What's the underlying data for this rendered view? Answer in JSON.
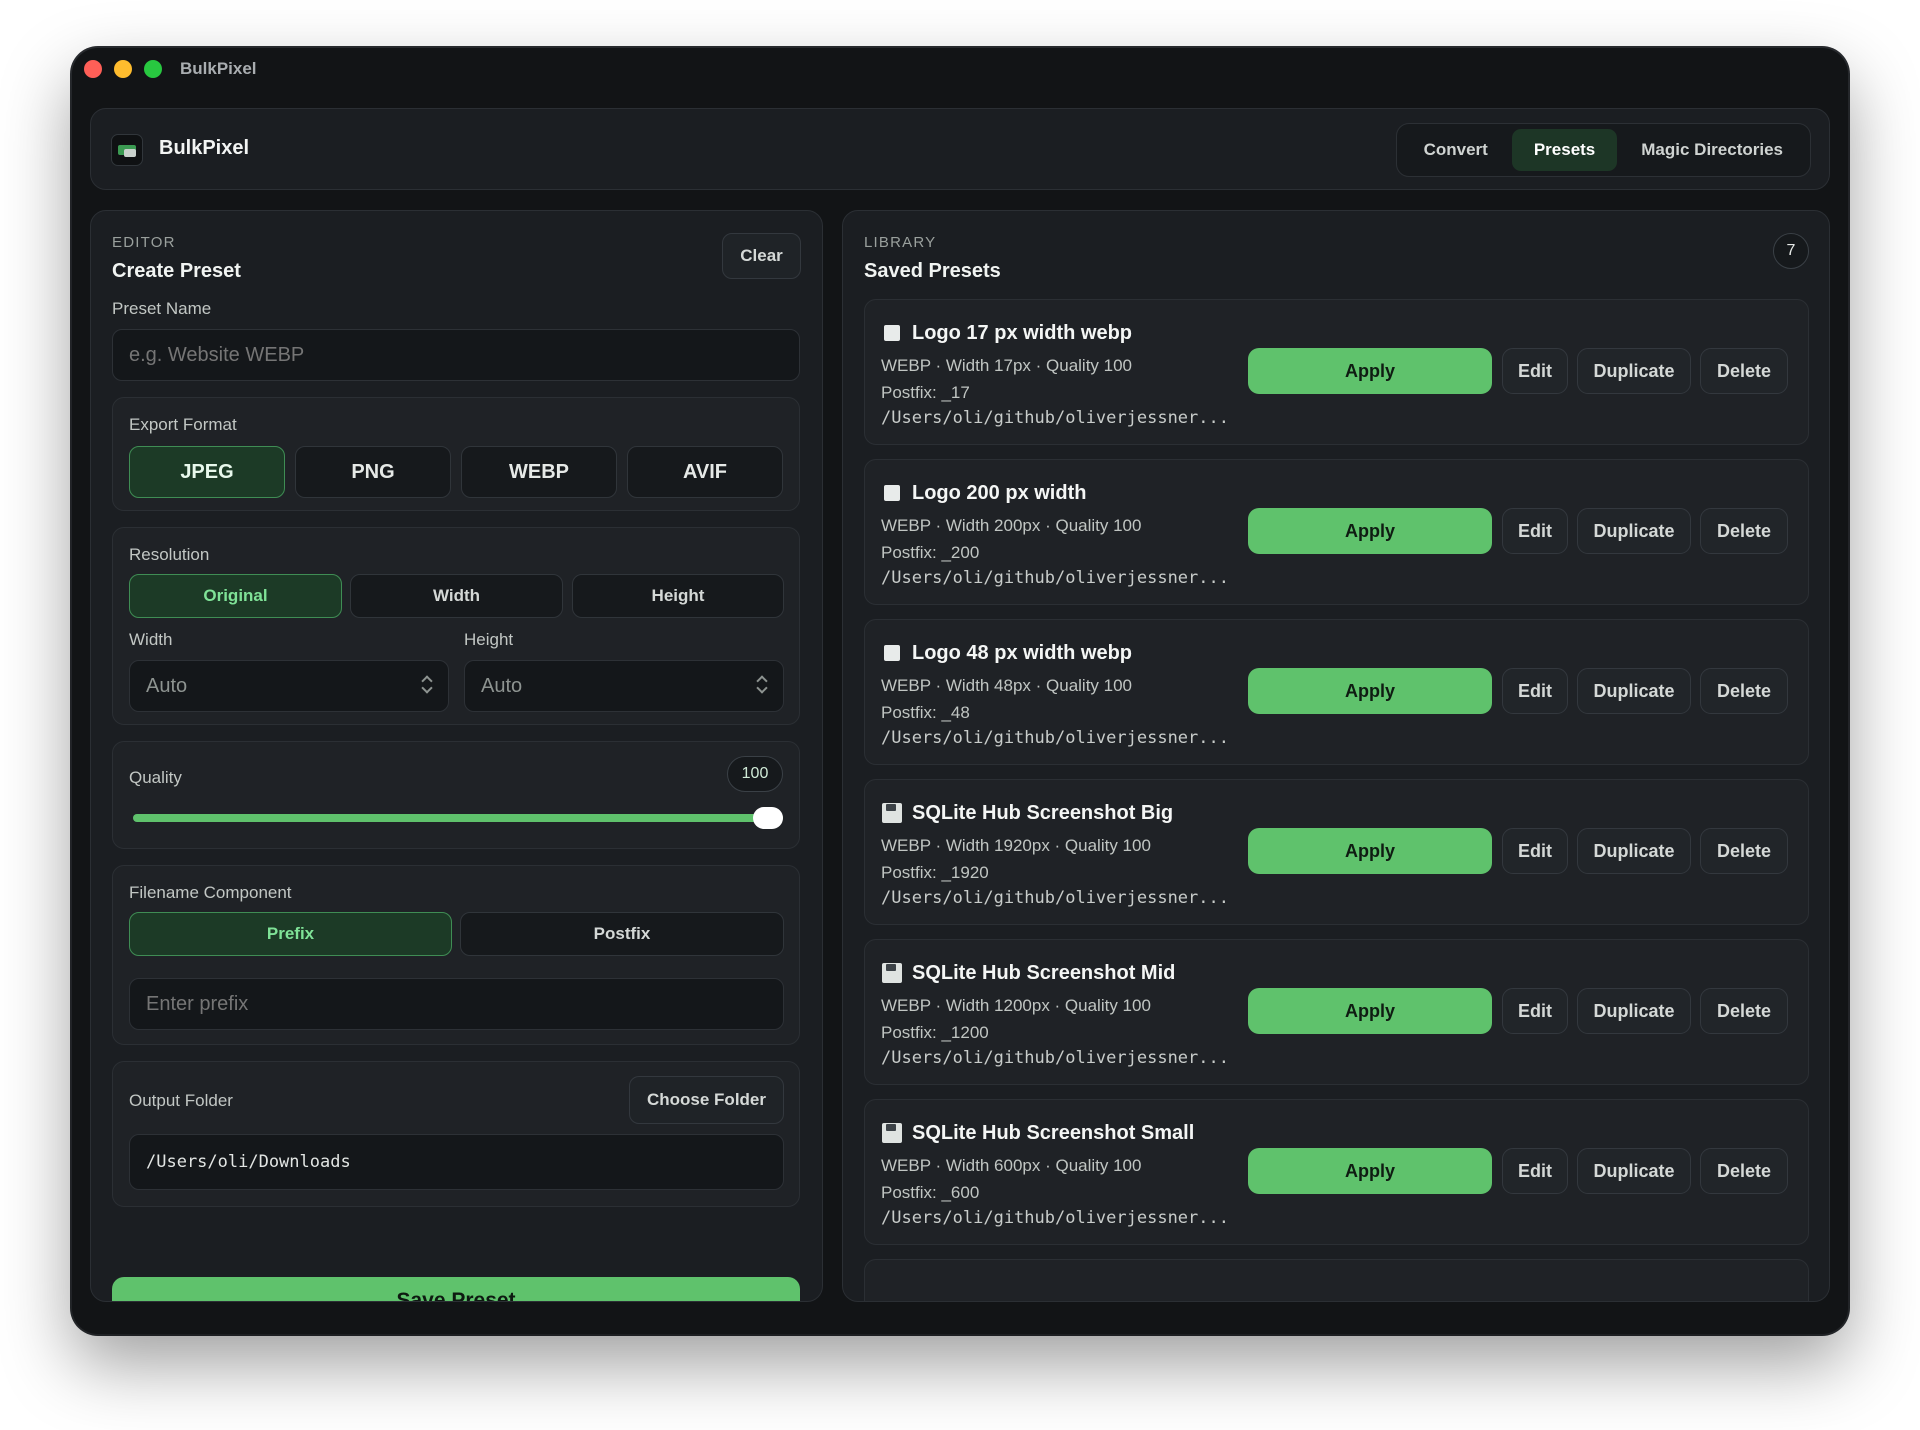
{
  "window": {
    "title": "BulkPixel"
  },
  "header": {
    "app_name": "BulkPixel",
    "tabs": [
      {
        "label": "Convert",
        "active": false
      },
      {
        "label": "Presets",
        "active": true
      },
      {
        "label": "Magic Directories",
        "active": false
      }
    ]
  },
  "editor": {
    "eyebrow": "EDITOR",
    "title": "Create Preset",
    "clear_label": "Clear",
    "preset_name_label": "Preset Name",
    "preset_name_placeholder": "e.g. Website WEBP",
    "export_format_label": "Export Format",
    "formats": [
      "JPEG",
      "PNG",
      "WEBP",
      "AVIF"
    ],
    "selected_format": "JPEG",
    "resolution_label": "Resolution",
    "resolution_modes": [
      "Original",
      "Width",
      "Height"
    ],
    "selected_resolution_mode": "Original",
    "width_label": "Width",
    "width_value": "Auto",
    "height_label": "Height",
    "height_value": "Auto",
    "quality_label": "Quality",
    "quality_value": "100",
    "quality_fraction": 1.0,
    "filename_label": "Filename Component",
    "filename_modes": [
      "Prefix",
      "Postfix"
    ],
    "selected_filename_mode": "Prefix",
    "prefix_placeholder": "Enter prefix",
    "output_folder_label": "Output Folder",
    "choose_folder_label": "Choose Folder",
    "output_folder_value": "/Users/oli/Downloads",
    "save_label": "Save Preset"
  },
  "library": {
    "eyebrow": "LIBRARY",
    "title": "Saved Presets",
    "count": "7",
    "apply_label": "Apply",
    "edit_label": "Edit",
    "duplicate_label": "Duplicate",
    "delete_label": "Delete",
    "presets": [
      {
        "icon": "square-icon",
        "name": "Logo 17 px width webp",
        "meta": "WEBP · Width 17px · Quality 100",
        "postfix": "Postfix: _17",
        "path": "/Users/oli/github/oliverjessner..."
      },
      {
        "icon": "square-icon",
        "name": "Logo 200 px width",
        "meta": "WEBP · Width 200px · Quality 100",
        "postfix": "Postfix: _200",
        "path": "/Users/oli/github/oliverjessner..."
      },
      {
        "icon": "square-icon",
        "name": "Logo 48 px width webp",
        "meta": "WEBP · Width 48px · Quality 100",
        "postfix": "Postfix: _48",
        "path": "/Users/oli/github/oliverjessner..."
      },
      {
        "icon": "floppy-disk-icon",
        "name": "SQLite Hub Screenshot Big",
        "meta": "WEBP · Width 1920px · Quality 100",
        "postfix": "Postfix: _1920",
        "path": "/Users/oli/github/oliverjessner..."
      },
      {
        "icon": "floppy-disk-icon",
        "name": "SQLite Hub Screenshot Mid",
        "meta": "WEBP · Width 1200px · Quality 100",
        "postfix": "Postfix: _1200",
        "path": "/Users/oli/github/oliverjessner..."
      },
      {
        "icon": "floppy-disk-icon",
        "name": "SQLite Hub Screenshot Small",
        "meta": "WEBP · Width 600px · Quality 100",
        "postfix": "Postfix: _600",
        "path": "/Users/oli/github/oliverjessner..."
      }
    ]
  },
  "colors": {
    "accent": "#5fc26c",
    "selected_bg": "#1c3a26",
    "selected_text": "#7fe297",
    "window_bg": "#121416",
    "panel_bg": "#1b1e22"
  }
}
